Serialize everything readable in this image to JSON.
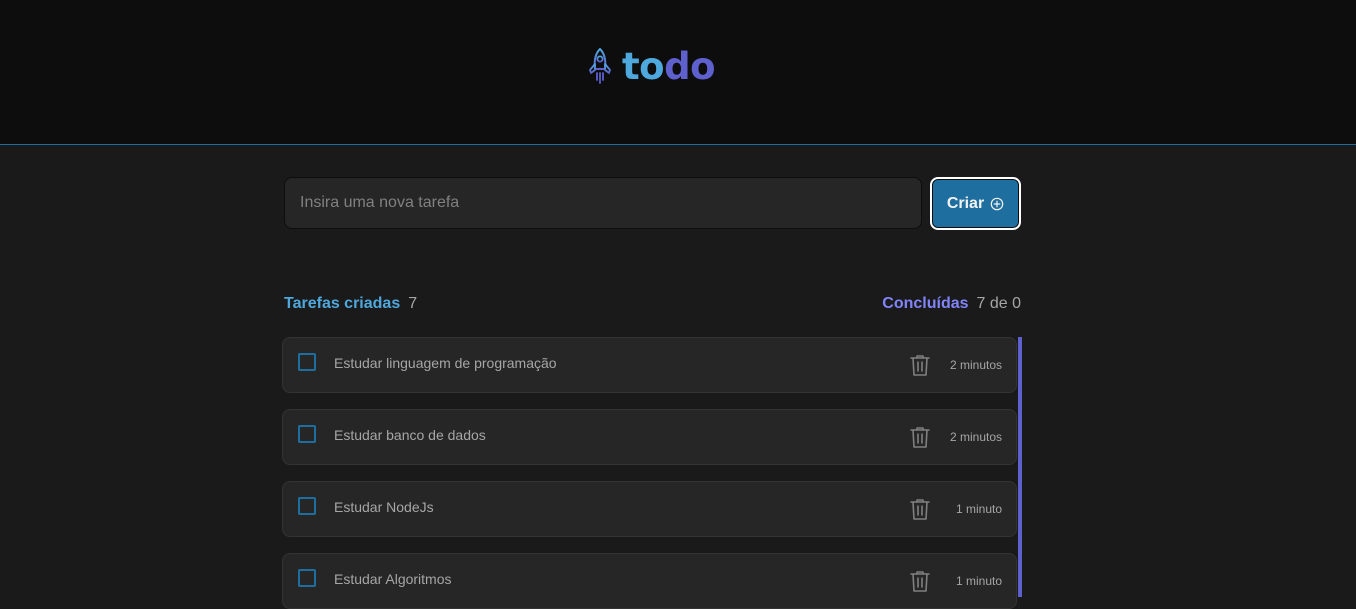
{
  "header": {
    "logo_icon": "rocket-icon",
    "logo_part1": "to",
    "logo_part2": "do"
  },
  "new_task": {
    "placeholder": "Insira uma nova tarefa",
    "value": "",
    "create_label": "Criar",
    "create_icon": "plus-circle-icon"
  },
  "counters": {
    "created_label": "Tarefas criadas",
    "created_count": "7",
    "done_label": "Concluídas",
    "done_count": "7 de 0"
  },
  "tasks": [
    {
      "text": "Estudar linguagem de programação",
      "time": "2 minutos",
      "done": false
    },
    {
      "text": "Estudar banco de dados",
      "time": "2 minutos",
      "done": false
    },
    {
      "text": "Estudar NodeJs",
      "time": "1 minuto",
      "done": false
    },
    {
      "text": "Estudar Algoritmos",
      "time": "1 minuto",
      "done": false
    }
  ],
  "colors": {
    "blue": "#4ea8de",
    "blue_dark": "#1e6f9f",
    "purple": "#5e60ce",
    "purple_light": "#8284fa",
    "background": "#1a1a1a",
    "header_bg": "#0d0d0d"
  }
}
